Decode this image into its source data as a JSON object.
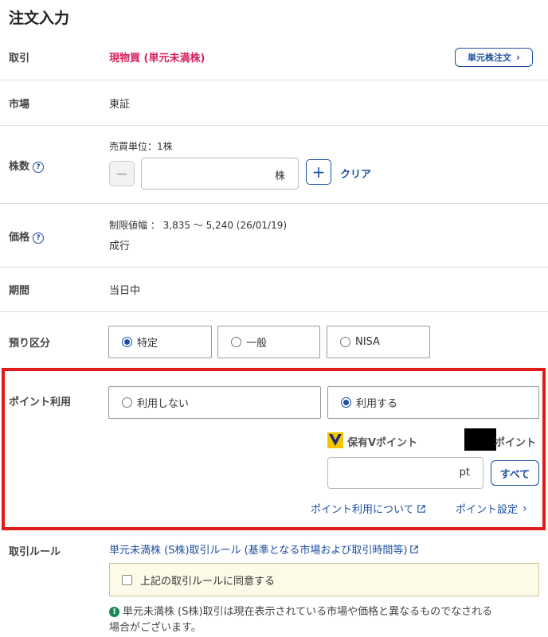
{
  "page": {
    "title": "注文入力"
  },
  "rows": {
    "trade": {
      "label": "取引",
      "value": "現物買 (単元未満株)",
      "unit_order_button": "単元株注文"
    },
    "market": {
      "label": "市場",
      "value": "東証"
    },
    "shares": {
      "label": "株数",
      "trade_unit": "売買単位：1株",
      "unit": "株",
      "value": "",
      "clear": "クリア"
    },
    "price": {
      "label": "価格",
      "range": "制限値幅 ： 3,835 〜 5,240 (26/01/19)",
      "value": "成行"
    },
    "period": {
      "label": "期間",
      "value": "当日中"
    },
    "account": {
      "label": "預り区分",
      "options": [
        "特定",
        "一般",
        "NISA"
      ],
      "selected": "特定"
    },
    "points": {
      "label": "ポイント利用",
      "options": [
        "利用しない",
        "利用する"
      ],
      "selected": "利用する",
      "held_label": "保有Vポイント",
      "held_unit": "ポイント",
      "input_unit": "pt",
      "input_value": "",
      "all_button": "すべて",
      "about_link": "ポイント利用について",
      "settings_link": "ポイント設定"
    },
    "rules": {
      "label": "取引ルール",
      "link": "単元未満株 (S株)取引ルール (基準となる市場および取引時間等)",
      "agree": "上記の取引ルールに同意する",
      "note_line1": "単元未満株 (S株)取引は現在表示されている市場や価格と異なるものでなされる",
      "note_line2": "場合がございます。"
    }
  },
  "colors": {
    "accent": "#1d4fa0",
    "trade_type": "#d6225a",
    "highlight": "#e11b1b",
    "vpoint_logo": "#f5c400"
  }
}
